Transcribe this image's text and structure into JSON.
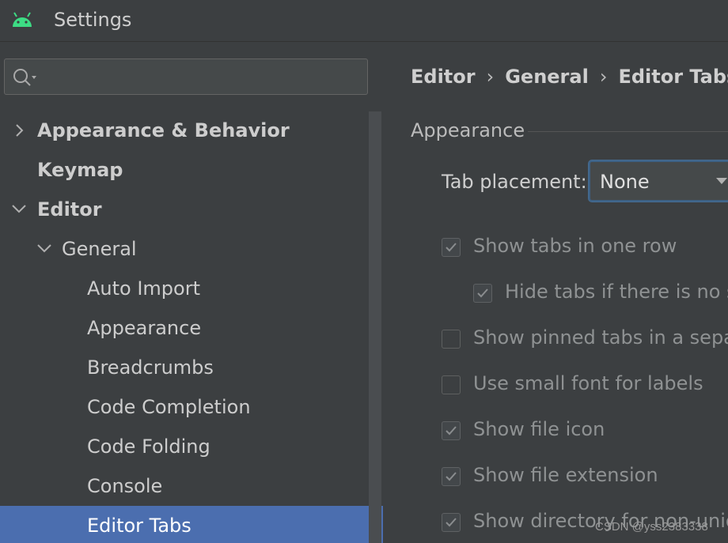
{
  "window": {
    "title": "Settings"
  },
  "search": {
    "placeholder": ""
  },
  "tree": [
    {
      "label": "Appearance & Behavior",
      "expanded": false
    },
    {
      "label": "Keymap"
    },
    {
      "label": "Editor",
      "expanded": true
    },
    {
      "label": "General",
      "expanded": true
    },
    {
      "label": "Auto Import"
    },
    {
      "label": "Appearance"
    },
    {
      "label": "Breadcrumbs"
    },
    {
      "label": "Code Completion"
    },
    {
      "label": "Code Folding"
    },
    {
      "label": "Console"
    },
    {
      "label": "Editor Tabs",
      "selected": true
    }
  ],
  "breadcrumb": {
    "items": [
      "Editor",
      "General",
      "Editor Tabs"
    ],
    "separator": "›"
  },
  "panel": {
    "group_title": "Appearance",
    "tab_placement_label": "Tab placement:",
    "tab_placement_value": "None",
    "options": [
      {
        "label": "Show tabs in one row",
        "checked": true
      },
      {
        "label": "Hide tabs if there is no sp",
        "checked": true
      },
      {
        "label": "Show pinned tabs in a separ",
        "checked": false
      },
      {
        "label": "Use small font for labels",
        "checked": false
      },
      {
        "label": "Show file icon",
        "checked": true
      },
      {
        "label": "Show file extension",
        "checked": true
      },
      {
        "label": "Show directory for non-uniq",
        "checked": true
      }
    ]
  },
  "watermark": "CSDN @yss2383338",
  "colors": {
    "background": "#3c3f41",
    "selection": "#4b6eaf",
    "android_green": "#3ddc84",
    "focus_border": "#3d6185"
  }
}
